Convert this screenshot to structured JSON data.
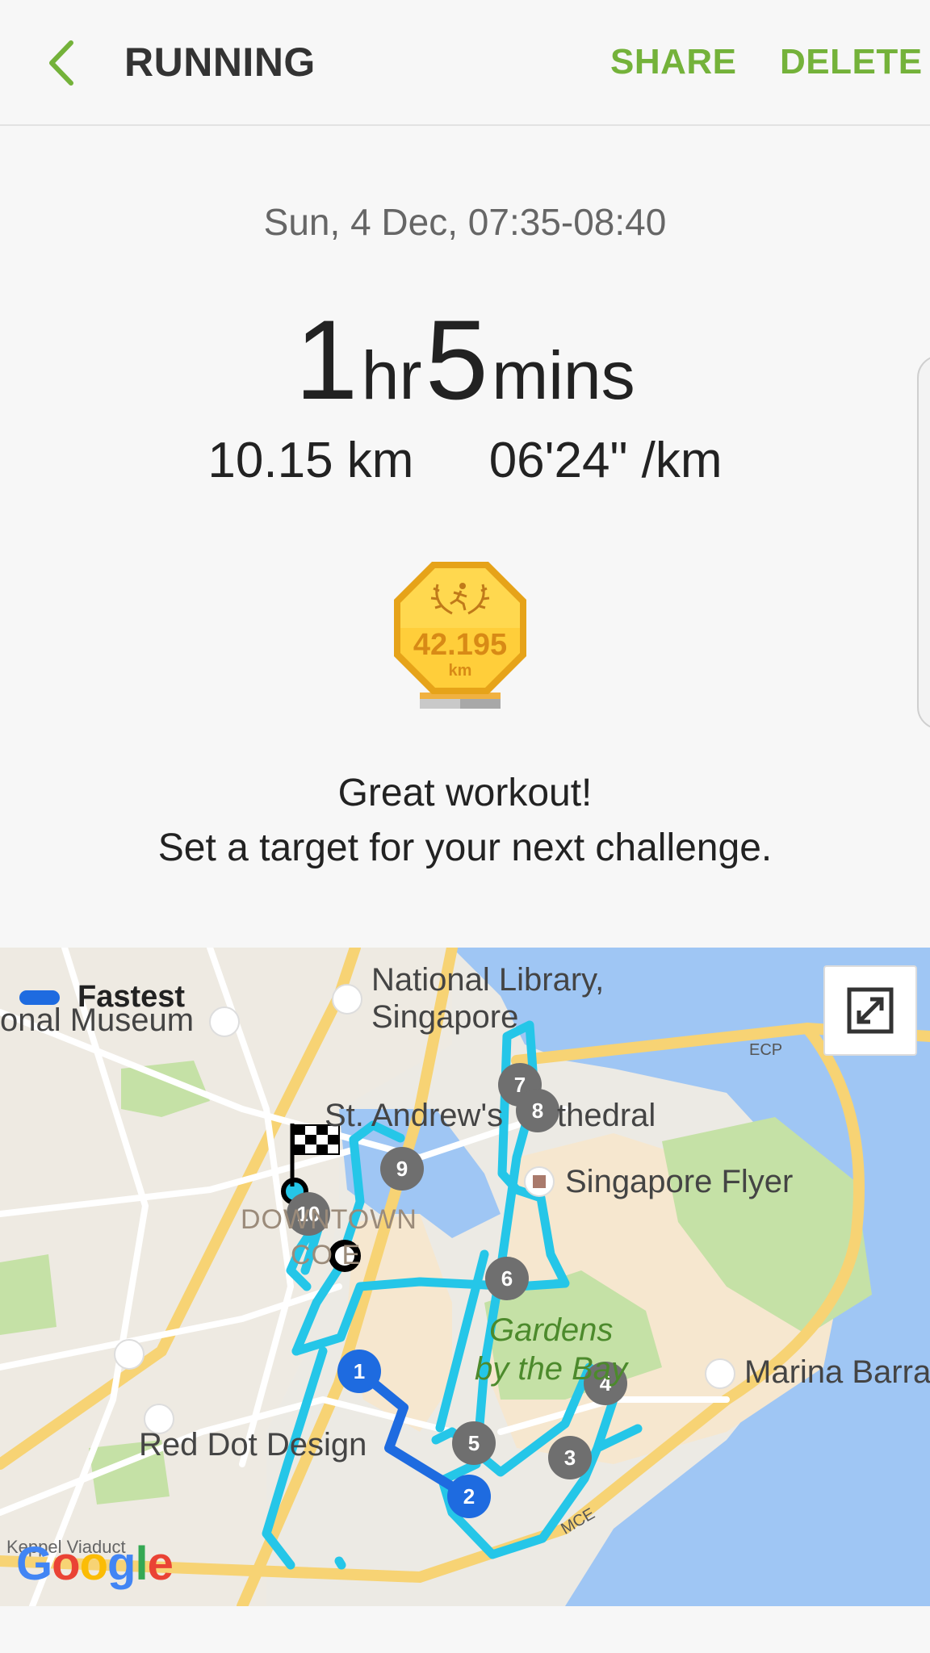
{
  "app": {
    "title": "RUNNING",
    "share_label": "SHARE",
    "delete_label": "DELETE"
  },
  "workout": {
    "date_time": "Sun, 4 Dec, 07:35-08:40",
    "duration_hours": "1",
    "hours_unit": "hr",
    "duration_minutes": "5",
    "minutes_unit": "mins",
    "distance": "10.15 km",
    "pace": "06'24\" /km"
  },
  "medal": {
    "value": "42.195",
    "unit": "km",
    "icon": "runner-laurel-icon"
  },
  "message": {
    "line1": "Great workout!",
    "line2": "Set a target for your next challenge."
  },
  "map": {
    "legend_label": "Fastest",
    "legend_color": "#1e6be0",
    "route_color": "#25c6e8",
    "fast_segment_color": "#1e6be0",
    "labels": {
      "museum": "onal Museum",
      "library_1": "National Library,",
      "library_2": "Singapore",
      "cathedral": "St. Andrew's",
      "cathedral_2": "thedral",
      "flyer": "Singapore Flyer",
      "downtown": "DOWNTOWN",
      "core": "CO   E",
      "gardens_1": "Gardens",
      "gardens_2": "by the Bay",
      "marina": "Marina Barra",
      "red_dot": "Red Dot Design",
      "ecp": "ECP",
      "mce": "MCE",
      "viaduct": "Keppel Viaduct",
      "google": "Google"
    },
    "km_markers": [
      "1",
      "2",
      "3",
      "4",
      "5",
      "6",
      "7",
      "8",
      "9",
      "10"
    ]
  }
}
